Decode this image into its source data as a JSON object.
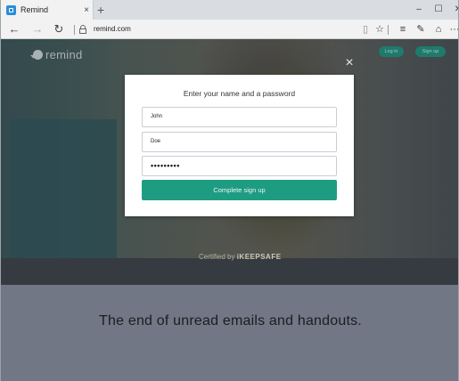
{
  "browser": {
    "tab_title": "Remind",
    "tab_close": "×",
    "new_tab": "+",
    "url": "remind.com",
    "window_controls": [
      "–",
      "☐",
      "✕"
    ],
    "nav": {
      "back": "←",
      "forward": "→",
      "refresh": "↻"
    },
    "tools": {
      "reading_view": "▯",
      "favorite": "☆",
      "hub": "≡",
      "notes": "✎",
      "share": "⌂",
      "more": "···"
    }
  },
  "site": {
    "logo_text": "remind",
    "login_label": "Log in",
    "signup_label": "Sign up",
    "certified_prefix": "Certified by",
    "certified_brand": "iKEEPSAFE",
    "tagline": "The end of unread emails and handouts."
  },
  "modal": {
    "close": "×",
    "title": "Enter your name and a password",
    "first_name": "John",
    "last_name": "Doe",
    "password_mask": "•••••••••",
    "submit_label": "Complete sign up"
  },
  "colors": {
    "accent": "#1e9c82",
    "tab_icon": "#2a8cd8"
  }
}
